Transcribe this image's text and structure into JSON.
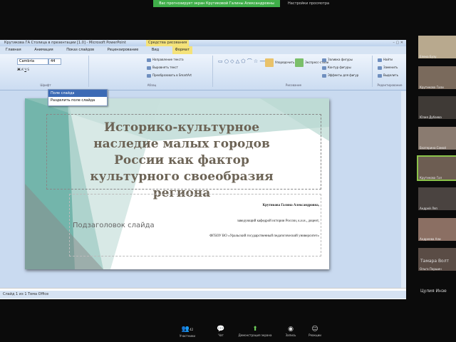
{
  "meeting": {
    "banner_text": "Вас прогнозирует экран Крутиковой Галины Александровны",
    "view_options": "Настройки просмотра"
  },
  "ppt": {
    "window_title": "Крутикова ГА Столица в презентации [1.0] - Microsoft PowerPoint",
    "tools_label": "Средства рисования",
    "tabs": [
      "Главная",
      "Анимация",
      "Показ слайдов",
      "Рецензирование",
      "Вид",
      "Формат"
    ],
    "font_name": "Cambria",
    "font_size": "44",
    "ribbon_groups": [
      "Шрифт",
      "Абзац",
      "Рисование",
      "Редактирование"
    ],
    "ribbon_buttons": [
      "Направление текста",
      "Выровнять текст",
      "Преобразовать в SmartArt",
      "Упорядочить",
      "Экспресс-стили",
      "Заливка фигуры",
      "Контур фигуры",
      "Эффекты для фигур",
      "Найти",
      "Заменить",
      "Выделить"
    ],
    "dropdown_items": [
      "Поле слайда",
      "Разделить поле слайда"
    ],
    "status_text": "Слайд 1 из 1  Тема Office"
  },
  "slide": {
    "title": "Историко-культурное наследие малых городов России как фактор культурного своеобразия региона",
    "subtitle_placeholder": "Подзаголовок слайда",
    "author": "Крутикова Галина Александровна,",
    "position": "заведующий кафедрой истории России, к.и.н., доцент,",
    "org": "ФГБОУ ВО «Уральский государственный педагогический университет»"
  },
  "participants": [
    {
      "name": "Елена Бузу"
    },
    {
      "name": "Крутикова Гали"
    },
    {
      "name": "Юлия Дубаева"
    },
    {
      "name": "Екатерина Самой"
    },
    {
      "name": "Крутикова Гал"
    },
    {
      "name": "Андрей Ляп"
    },
    {
      "name": "Андреева Али"
    },
    {
      "name": "Ольга Паршин"
    },
    {
      "name": "Тамара Волт"
    },
    {
      "name": "Цулия Инзе"
    }
  ],
  "toolbar": {
    "participants_label": "Участники",
    "participants_count": "42",
    "chat_label": "Чат",
    "share_label": "Демонстрация экрана",
    "reactions_label": "Запись",
    "leave_label": "Реакции"
  }
}
